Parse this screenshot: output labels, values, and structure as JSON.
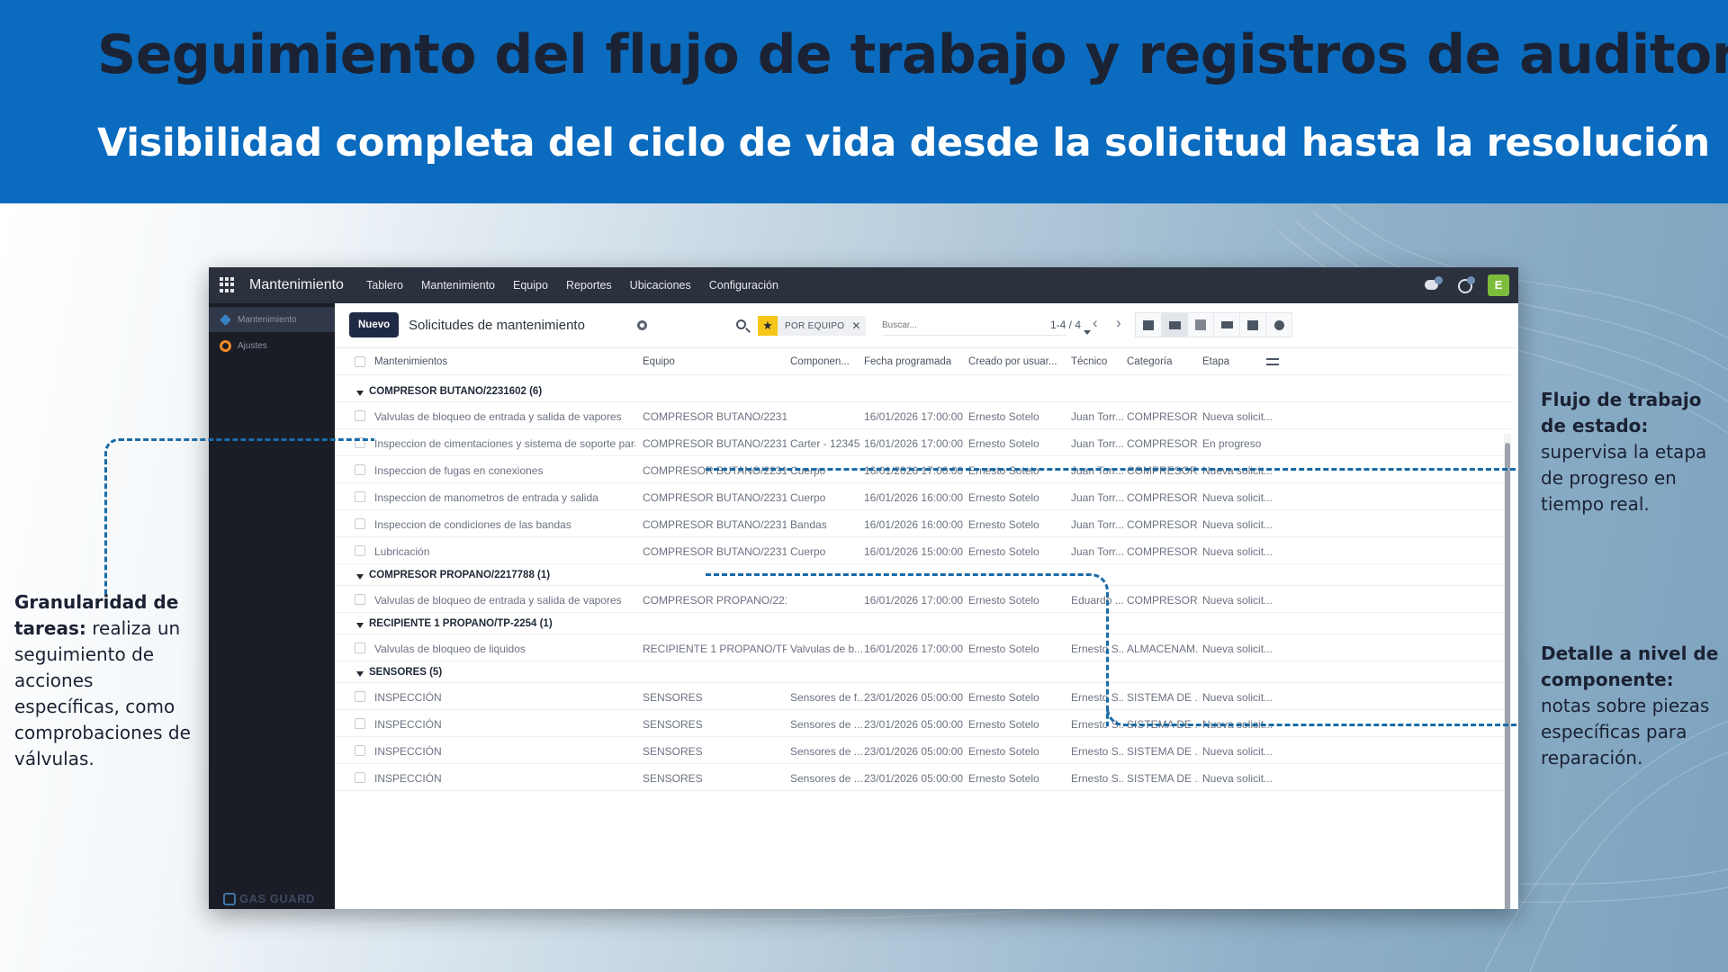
{
  "slide": {
    "title": "Seguimiento del flujo de trabajo y registros de auditoría",
    "subtitle": "Visibilidad completa del ciclo de vida desde la solicitud hasta la resolución",
    "accent_color": "#0a6bbf",
    "title_color": "#1b2233"
  },
  "app": {
    "name": "Mantenimiento",
    "menu": [
      "Tablero",
      "Mantenimiento",
      "Equipo",
      "Reportes",
      "Ubicaciones",
      "Configuración"
    ],
    "avatar_letter": "E",
    "sidebar": [
      "Mantenimiento",
      "Ajustes"
    ],
    "brand": "GAS GUARD",
    "new_button": "Nuevo",
    "view_title": "Solicitudes de mantenimiento",
    "facet_label": "POR EQUIPO",
    "search_placeholder": "Buscar...",
    "pager": "1-4 / 4",
    "columns": [
      "Mantenimientos",
      "Equipo",
      "Componen...",
      "Fecha programada",
      "Creado por usuar...",
      "Técnico",
      "Categoría",
      "Etapa"
    ]
  },
  "rows": [
    {
      "type": "group",
      "label": "COMPRESOR BUTANO/2231602 (6)"
    },
    {
      "type": "record",
      "cells": [
        "Valvulas de bloqueo de entrada y salida de vapores",
        "COMPRESOR BUTANO/22316...",
        "",
        "16/01/2026 17:00:00",
        "Ernesto Sotelo",
        "Juan Torr...",
        "COMPRESOR...",
        "Nueva solicit..."
      ]
    },
    {
      "type": "record",
      "cells": [
        "Inspeccion de cimentaciones y sistema de soporte para t...",
        "COMPRESOR BUTANO/22316...",
        "Carter - 12345",
        "16/01/2026 17:00:00",
        "Ernesto Sotelo",
        "Juan Torr...",
        "COMPRESOR...",
        "En progreso"
      ]
    },
    {
      "type": "record",
      "cells": [
        "Inspeccion de fugas en conexiones",
        "COMPRESOR BUTANO/22316...",
        "Cuerpo",
        "16/01/2026 17:00:00",
        "Ernesto Sotelo",
        "Juan Torr...",
        "COMPRESOR...",
        "Nueva solicit..."
      ]
    },
    {
      "type": "record",
      "cells": [
        "Inspeccion de manometros de entrada y salida",
        "COMPRESOR BUTANO/22316...",
        "Cuerpo",
        "16/01/2026 16:00:00",
        "Ernesto Sotelo",
        "Juan Torr...",
        "COMPRESOR...",
        "Nueva solicit..."
      ]
    },
    {
      "type": "record",
      "cells": [
        "Inspeccion de condiciones de las bandas",
        "COMPRESOR BUTANO/22316...",
        "Bandas",
        "16/01/2026 16:00:00",
        "Ernesto Sotelo",
        "Juan Torr...",
        "COMPRESOR...",
        "Nueva solicit..."
      ]
    },
    {
      "type": "record",
      "cells": [
        "Lubricación",
        "COMPRESOR BUTANO/22316...",
        "Cuerpo",
        "16/01/2026 15:00:00",
        "Ernesto Sotelo",
        "Juan Torr...",
        "COMPRESOR...",
        "Nueva solicit..."
      ]
    },
    {
      "type": "group",
      "label": "COMPRESOR PROPANO/2217788 (1)"
    },
    {
      "type": "record",
      "cells": [
        "Valvulas de bloqueo de entrada y salida de vapores",
        "COMPRESOR PROPANO/2217...",
        "",
        "16/01/2026 17:00:00",
        "Ernesto Sotelo",
        "Eduardo ...",
        "COMPRESOR...",
        "Nueva solicit..."
      ]
    },
    {
      "type": "group",
      "label": "RECIPIENTE 1 PROPANO/TP-2254 (1)"
    },
    {
      "type": "record",
      "cells": [
        "Valvulas de bloqueo de liquidos",
        "RECIPIENTE 1 PROPANO/TP-2...",
        "Valvulas de b...",
        "16/01/2026 17:00:00",
        "Ernesto Sotelo",
        "Ernesto S...",
        "ALMACENAM...",
        "Nueva solicit..."
      ]
    },
    {
      "type": "group",
      "label": "SENSORES (5)"
    },
    {
      "type": "record",
      "cells": [
        "INSPECCIÓN",
        "SENSORES",
        "Sensores de f...",
        "23/01/2026 05:00:00",
        "Ernesto Sotelo",
        "Ernesto S...",
        "SISTEMA DE ...",
        "Nueva solicit..."
      ]
    },
    {
      "type": "record",
      "cells": [
        "INSPECCIÓN",
        "SENSORES",
        "Sensores de ...",
        "23/01/2026 05:00:00",
        "Ernesto Sotelo",
        "Ernesto S...",
        "SISTEMA DE ...",
        "Nueva solicit..."
      ]
    },
    {
      "type": "record",
      "cells": [
        "INSPECCIÓN",
        "SENSORES",
        "Sensores de ...",
        "23/01/2026 05:00:00",
        "Ernesto Sotelo",
        "Ernesto S...",
        "SISTEMA DE ...",
        "Nueva solicit..."
      ]
    },
    {
      "type": "record",
      "cells": [
        "INSPECCIÓN",
        "SENSORES",
        "Sensores de ...",
        "23/01/2026 05:00:00",
        "Ernesto Sotelo",
        "Ernesto S...",
        "SISTEMA DE ...",
        "Nueva solicit..."
      ]
    }
  ],
  "annotations": {
    "left": {
      "bold": "Granularidad de tareas:",
      "text": " realiza un seguimiento de acciones específicas, como comprobaciones de válvulas."
    },
    "right_top": {
      "bold": "Flujo de trabajo de estado:",
      "text": " supervisa la etapa de progreso en tiempo real."
    },
    "right_bottom": {
      "bold": "Detalle a nivel de componente:",
      "text": " notas sobre piezas específicas para reparación."
    }
  }
}
